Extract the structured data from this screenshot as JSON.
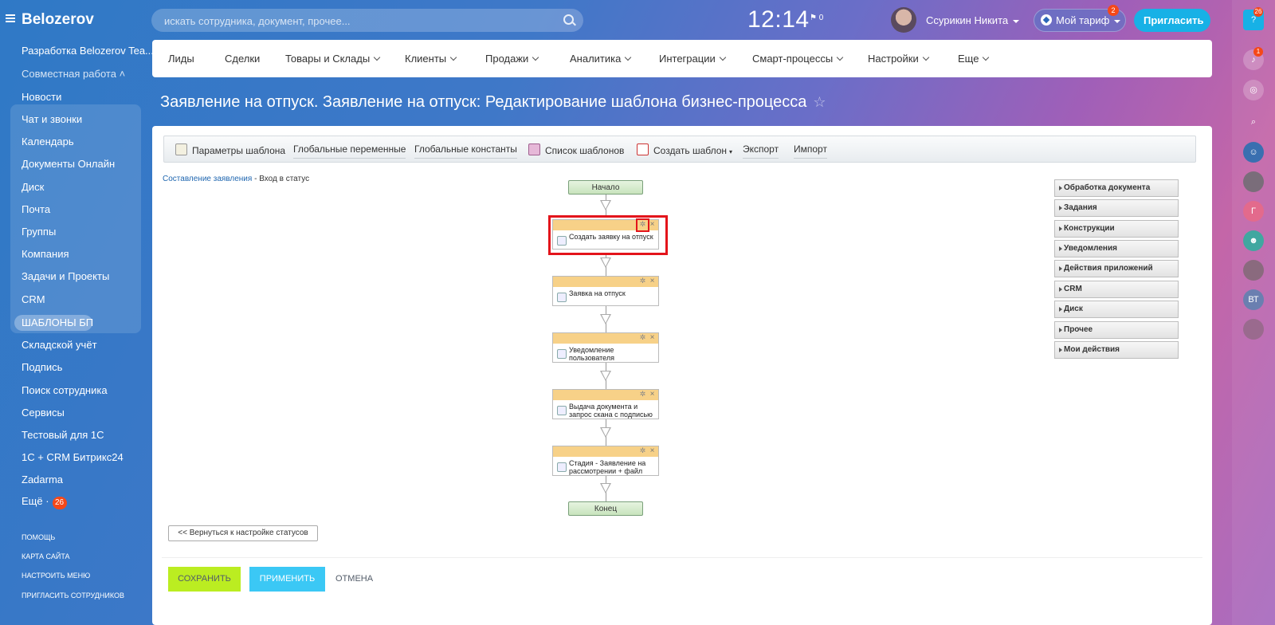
{
  "header": {
    "logo": "Belozerov",
    "search_placeholder": "искать сотрудника, документ, прочее...",
    "time": "12:14",
    "flag_count": "0",
    "user_name": "Ссурикин Никита",
    "tariff_label": "Мой тариф",
    "tariff_badge": "2",
    "invite_label": "Пригласить"
  },
  "sidebar": {
    "portal": "Разработка Belozerov Tea...",
    "group_label": "Совместная работа",
    "group_items": [
      "Новости",
      "Чат и звонки",
      "Календарь",
      "Документы Онлайн",
      "Диск",
      "Почта",
      "Группы",
      "Компания",
      "Задачи и Проекты"
    ],
    "crm": "CRM",
    "active": "ШАБЛОНЫ БП",
    "items": [
      "Складской учёт",
      "Подпись",
      "Поиск сотрудника",
      "Сервисы",
      "Тестовый для 1С",
      "1С + CRM Битрикс24",
      "Zadarma"
    ],
    "more": "Ещё ·",
    "more_badge": "26",
    "footer": [
      "ПОМОЩЬ",
      "КАРТА САЙТА",
      "НАСТРОИТЬ МЕНЮ",
      "ПРИГЛАСИТЬ СОТРУДНИКОВ"
    ]
  },
  "rail": {
    "help_badge": "26",
    "bell_badge": "1",
    "avatar_g": "Г",
    "avatar_vt": "ВТ"
  },
  "menu": [
    "Лиды",
    "Сделки",
    "Товары и Склады",
    "Клиенты",
    "Продажи",
    "Аналитика",
    "Интеграции",
    "Смарт-процессы",
    "Настройки",
    "Еще"
  ],
  "page_title": "Заявление на отпуск. Заявление на отпуск: Редактирование шаблона бизнес-процесса",
  "toolbar": [
    "Параметры шаблона",
    "Глобальные переменные",
    "Глобальные константы",
    "Список шаблонов",
    "Создать шаблон",
    "Экспорт",
    "Импорт"
  ],
  "breadcrumb": {
    "link": "Составление заявления",
    "current": "- Вход в статус"
  },
  "flow": {
    "start": "Начало",
    "end": "Конец",
    "activities": [
      "Создать заявку на отпуск",
      "Заявка на отпуск",
      "Уведомление пользователя",
      "Выдача документа и запрос скана с подписью",
      "Стадия - Заявление на рассмотрении + файл"
    ]
  },
  "palette": [
    "Обработка документа",
    "Задания",
    "Конструкции",
    "Уведомления",
    "Действия приложений",
    "CRM",
    "Диск",
    "Прочее",
    "Мои действия"
  ],
  "buttons": {
    "back": "<< Вернуться к настройке статусов",
    "save": "СОХРАНИТЬ",
    "apply": "ПРИМЕНИТЬ",
    "cancel": "ОТМЕНА"
  }
}
